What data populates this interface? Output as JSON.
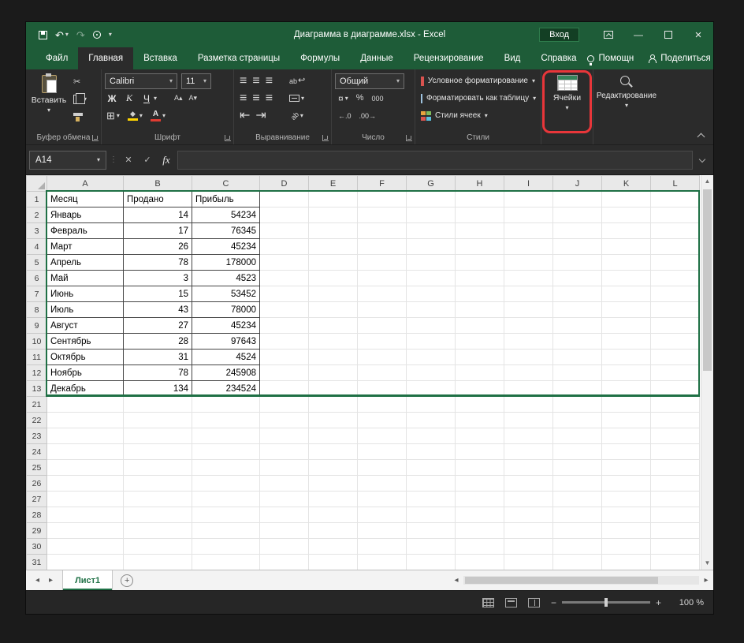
{
  "titlebar": {
    "title": "Диаграмма в диаграмме.xlsx - Excel",
    "signin_label": "Вход"
  },
  "tabs": {
    "file": "Файл",
    "items": [
      "Главная",
      "Вставка",
      "Разметка страницы",
      "Формулы",
      "Данные",
      "Рецензирование",
      "Вид",
      "Справка"
    ],
    "active": "Главная",
    "assistant": "Помощн",
    "share": "Поделиться"
  },
  "ribbon": {
    "paste_label": "Вставить",
    "font_name": "Calibri",
    "font_size": "11",
    "bold": "Ж",
    "italic": "К",
    "underline": "Ч",
    "number_format": "Общий",
    "percent": "%",
    "thousands": "000",
    "cond_format": "Условное форматирование",
    "format_table": "Форматировать как таблицу",
    "cell_styles": "Стили ячеек",
    "cells_label": "Ячейки",
    "editing_label": "Редактирование",
    "group_labels": {
      "clipboard": "Буфер обмена",
      "font": "Шрифт",
      "alignment": "Выравнивание",
      "number": "Число",
      "styles": "Стили"
    }
  },
  "formula_bar": {
    "name_box": "A14",
    "fx_label": "fx",
    "value": ""
  },
  "grid": {
    "col_headers": [
      "A",
      "B",
      "C",
      "D",
      "E",
      "F",
      "G",
      "H",
      "I",
      "J",
      "K",
      "L"
    ],
    "row_numbers": [
      1,
      2,
      3,
      4,
      5,
      6,
      7,
      8,
      9,
      10,
      11,
      12,
      13,
      21,
      22,
      23,
      24,
      25,
      26,
      27,
      28,
      29,
      30,
      31
    ],
    "cells": [
      [
        "Месяц",
        "Продано",
        "Прибыль"
      ],
      [
        "Январь",
        "14",
        "54234"
      ],
      [
        "Февраль",
        "17",
        "76345"
      ],
      [
        "Март",
        "26",
        "45234"
      ],
      [
        "Апрель",
        "78",
        "178000"
      ],
      [
        "Май",
        "3",
        "4523"
      ],
      [
        "Июнь",
        "15",
        "53452"
      ],
      [
        "Июль",
        "43",
        "78000"
      ],
      [
        "Август",
        "27",
        "45234"
      ],
      [
        "Сентябрь",
        "28",
        "97643"
      ],
      [
        "Октябрь",
        "31",
        "4524"
      ],
      [
        "Ноябрь",
        "78",
        "245908"
      ],
      [
        "Декабрь",
        "134",
        "234524"
      ]
    ]
  },
  "sheetbar": {
    "sheet_name": "Лист1"
  },
  "statusbar": {
    "zoom_label": "100 %"
  },
  "icons": {
    "caret_down": "▾",
    "scissors": "✂",
    "undo": "↶",
    "redo": "↷",
    "check": "✓",
    "cancel": "✕",
    "dots": "⋮",
    "borders": "⊞",
    "align_lines": "≡",
    "wrap_text": "↩",
    "indent_dec": "⇤",
    "indent_inc": "⇥",
    "currency": "¤",
    "inc_decimal": "←.0",
    "dec_decimal": ".00→",
    "arrow_up": "▲",
    "arrow_down": "▼",
    "arrow_left": "◂",
    "arrow_right": "▸",
    "minus": "−",
    "plus": "+",
    "close": "×",
    "minimize": "—",
    "font_grow": "А▴",
    "font_shrink": "А▾",
    "orientation": "ab",
    "fill_diamond": "◆",
    "font_color_letter": "А"
  },
  "colors": {
    "titlebar_green": "#1e5c38",
    "accent_green": "#1f7045",
    "annotation_red": "#e8363a",
    "fill_yellow": "#ffd400",
    "font_color_red": "#e03c32"
  }
}
